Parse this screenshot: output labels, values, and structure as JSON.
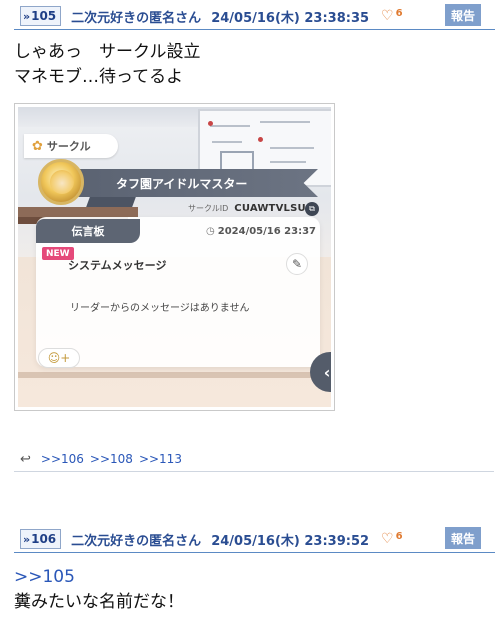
{
  "posts": [
    {
      "number_label": "105",
      "author": "二次元好きの匿名さん",
      "date": "24/05/16(木) 23:38:35",
      "likes": "6",
      "report_label": "報告",
      "body_lines": [
        "しゃあっ　サークル設立",
        "マネモブ…待ってるよ"
      ],
      "replies": [
        ">>106",
        ">>108",
        ">>113"
      ]
    },
    {
      "number_label": "106",
      "author": "二次元好きの匿名さん",
      "date": "24/05/16(木) 23:39:52",
      "likes": "6",
      "report_label": "報告",
      "anchor": ">>105",
      "body_lines": [
        "糞みたいな名前だな！"
      ]
    }
  ],
  "game_screenshot": {
    "circle_tag": "サークル",
    "circle_name": "タフ園アイドルマスター",
    "circle_id_label": "サークルID",
    "circle_id": "CUAWTVLSU",
    "board_tab": "伝言板",
    "board_date": "2024/05/16 23:37",
    "new_badge": "NEW",
    "system_message": "システムメッセージ",
    "no_message_text": "リーダーからのメッセージはありません"
  },
  "icons": {
    "resnum_arrows": "»",
    "heart": "♡",
    "reply": "↩",
    "side_chevron": "‹",
    "clock": "◷",
    "pencil": "✎",
    "copy": "⧉",
    "emoji_add": "☺+",
    "circle_tag_icon": "✿"
  },
  "colors": {
    "header_text": "#2a4d92",
    "header_rule": "#5b8ac4",
    "report_bg": "#7f9fcc",
    "like": "#e07a30",
    "link": "#2a57b8"
  }
}
